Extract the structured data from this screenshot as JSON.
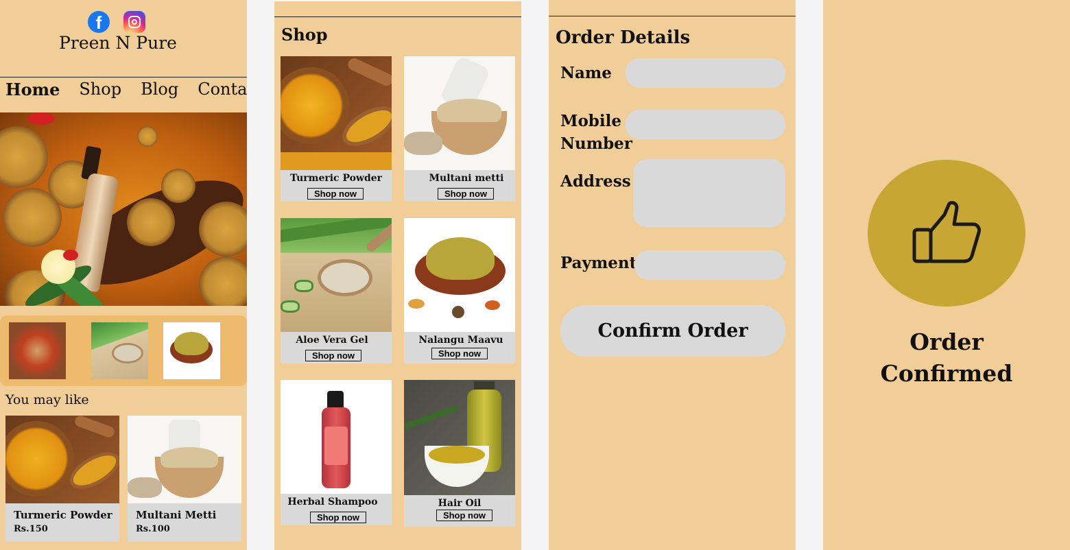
{
  "home": {
    "social_icons": [
      "facebook-icon",
      "instagram-icon"
    ],
    "facebook_glyph": "f",
    "brand": "Preen N Pure",
    "nav": [
      {
        "label": "Home"
      },
      {
        "label": "Shop"
      },
      {
        "label": "Blog"
      },
      {
        "label": "Contact"
      }
    ],
    "you_may_like": "You may like",
    "suggestions": [
      {
        "name": "Turmeric Powder",
        "price": "Rs.150"
      },
      {
        "name": "Multani Metti",
        "price": "Rs.100"
      }
    ]
  },
  "shop": {
    "title": "Shop",
    "products": [
      {
        "name": "Turmeric Powder",
        "button": "Shop now"
      },
      {
        "name": "Multani metti",
        "button": "Shop now"
      },
      {
        "name": "Aloe Vera Gel",
        "button": "Shop now"
      },
      {
        "name": "Nalangu Maavu",
        "button": "Shop now"
      },
      {
        "name": "Herbal Shampoo",
        "button": "Shop now"
      },
      {
        "name": "Hair Oil",
        "button": "Shop now"
      }
    ]
  },
  "order": {
    "title": "Order Details",
    "fields": {
      "name": {
        "label": "Name",
        "value": ""
      },
      "mobile": {
        "label": "Mobile Number",
        "value": ""
      },
      "address": {
        "label": "Address",
        "value": ""
      },
      "payment": {
        "label": "Payment",
        "value": ""
      }
    },
    "confirm_label": "Confirm Order"
  },
  "confirmed": {
    "icon": "thumbs-up-icon",
    "text": "Order Confirmed"
  },
  "colors": {
    "panel_bg": "#f1cd97",
    "page_bg": "#f4f4f4",
    "field_bg": "#d9d9d9",
    "thumb_strip": "#edbb6e",
    "confirm_circle": "#c8a634",
    "facebook": "#1877f2"
  }
}
